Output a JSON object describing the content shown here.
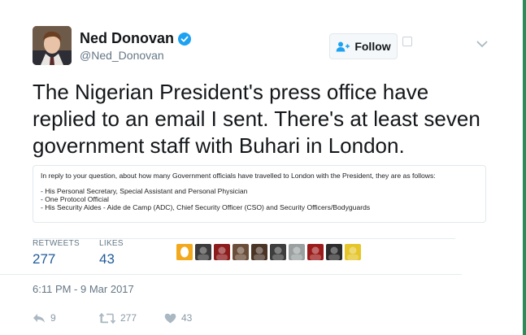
{
  "author": {
    "display_name": "Ned Donovan",
    "handle": "@Ned_Donovan",
    "verified": true
  },
  "follow_button": {
    "label": "Follow",
    "icon": "add-user-icon"
  },
  "tweet": {
    "text": "The Nigerian President's press office have replied to an email I sent. There's at least seven government staff with Buhari in London."
  },
  "attachment": {
    "intro": "In reply to your question, about how many Government officials have travelled to London with the President, they are as follows:",
    "lines": [
      "- His Personal Secretary, Special Assistant and Personal Physician",
      "- One Protocol Official",
      "- His Security Aides - Aide de Camp (ADC), Chief Security Officer (CSO) and Security Officers/Bodyguards"
    ]
  },
  "stats": {
    "retweets_label": "RETWEETS",
    "retweets_value": "277",
    "likes_label": "LIKES",
    "likes_value": "43"
  },
  "likers": [
    {
      "color": "#f2a91e"
    },
    {
      "color": "#3b3b3b"
    },
    {
      "color": "#8c1c1c"
    },
    {
      "color": "#6b4e3a"
    },
    {
      "color": "#4a3426"
    },
    {
      "color": "#3d3d3d"
    },
    {
      "color": "#9aa0a0"
    },
    {
      "color": "#9b1b1b"
    },
    {
      "color": "#2c2c2c"
    },
    {
      "color": "#e5c52a"
    }
  ],
  "timestamp": "6:11 PM - 9 Mar 2017",
  "actions": {
    "reply_count": "9",
    "retweet_count": "277",
    "like_count": "43"
  },
  "colors": {
    "accent": "#1da1f2",
    "value_blue": "#1f5a98",
    "muted": "#657786"
  }
}
